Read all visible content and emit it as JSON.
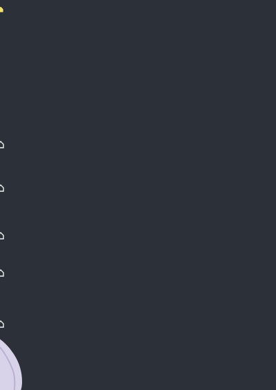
{
  "screen": {
    "background": "#2c3038"
  },
  "left_edge": {
    "icons": [
      {
        "name": "home-icon",
        "color": "#f2e36b"
      },
      {
        "name": "home-icon",
        "color": "#f2f2f2"
      },
      {
        "name": "home-icon",
        "color": "#f2f2f2"
      },
      {
        "name": "home-icon",
        "color": "#f2f2f2"
      },
      {
        "name": "home-icon",
        "color": "#f2f2f2"
      },
      {
        "name": "home-icon",
        "color": "#f2f2f2"
      }
    ]
  },
  "corner_artwork": {
    "name": "lavender-shape",
    "color": "#d9d3ea"
  }
}
